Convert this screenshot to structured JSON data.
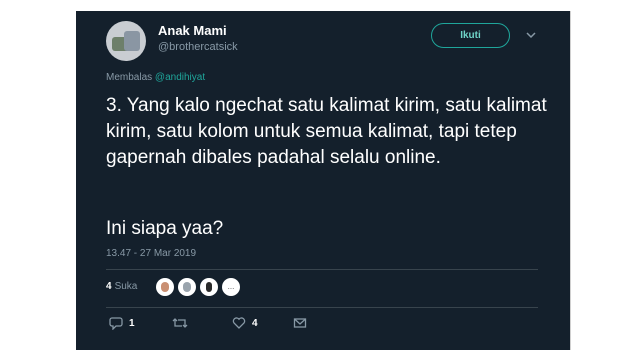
{
  "user": {
    "display_name": "Anak Mami",
    "handle": "@brothercatsick",
    "avatar": "avatar-photo"
  },
  "follow_button": {
    "label": "Ikuti"
  },
  "menu": {
    "icon": "chevron-down-icon"
  },
  "reply_context": {
    "prefix": "Membalas",
    "mention": "@andihiyat"
  },
  "tweet": {
    "text": "3. Yang kalo ngechat satu kalimat kirim, satu kalimat kirim, satu kolom untuk semua kalimat, tapi tetep gapernah dibales padahal selalu online.",
    "text2": "Ini siapa yaa?"
  },
  "timestamp": "13.47 - 27 Mar 2019",
  "likes": {
    "count": "4",
    "label": "Suka",
    "more": "..."
  },
  "actions": {
    "reply_count": "1",
    "like_count": "4"
  },
  "colors": {
    "background": "#14202c",
    "accent": "#1fa69b",
    "muted": "#8899a6"
  }
}
